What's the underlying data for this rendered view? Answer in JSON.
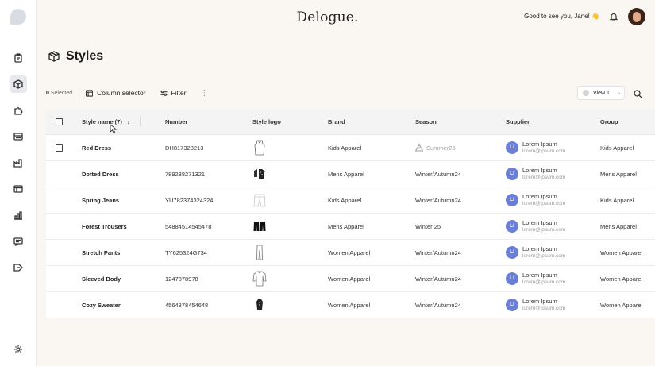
{
  "header": {
    "brand": "Delogue.",
    "greeting": "Good to see you, Jane! 👋"
  },
  "page": {
    "title": "Styles"
  },
  "toolbar": {
    "selected_count": "0",
    "selected_label": "Selected",
    "column_selector_label": "Column selector",
    "filter_label": "Filter",
    "view_label": "View 1"
  },
  "table": {
    "columns": [
      "Style name (7)",
      "Number",
      "Style logo",
      "Brand",
      "Season",
      "Supplier",
      "Group"
    ],
    "rows": [
      {
        "name": "Red Dress",
        "number": "DH817328213",
        "logo": "dress-icon",
        "brand": "Kids Apparel",
        "season": "Summer25",
        "season_warning": true,
        "supplier_initials": "LI",
        "supplier_name": "Lorem Ipsum",
        "supplier_email": "lorem@ipsum.com",
        "group": "Kids Apparel"
      },
      {
        "name": "Dotted Dress",
        "number": "789238271321",
        "logo": "dotted-dress-icon",
        "brand": "Mens Apparel",
        "season": "Winter/Autumn24",
        "season_warning": false,
        "supplier_initials": "LI",
        "supplier_name": "Lorem Ipsum",
        "supplier_email": "lorem@ipsum.com",
        "group": "Mens Apparel"
      },
      {
        "name": "Spring Jeans",
        "number": "YU782374324324",
        "logo": "jeans-icon",
        "brand": "Kids Apparel",
        "season": "Winter/Autumn24",
        "season_warning": false,
        "supplier_initials": "LI",
        "supplier_name": "Lorem Ipsum",
        "supplier_email": "lorem@ipsum.com",
        "group": "Kids Apparel"
      },
      {
        "name": "Forest Trousers",
        "number": "54884514545478",
        "logo": "trousers-icon",
        "brand": "Mens Apparel",
        "season": "Winter 25",
        "season_warning": false,
        "supplier_initials": "LI",
        "supplier_name": "Lorem Ipsum",
        "supplier_email": "lorem@ipsum.com",
        "group": "Mens Apparel"
      },
      {
        "name": "Stretch Pants",
        "number": "TY625324G734",
        "logo": "pants-icon",
        "brand": "Women Apparel",
        "season": "Winter/Autumn24",
        "season_warning": false,
        "supplier_initials": "LI",
        "supplier_name": "Lorem Ipsum",
        "supplier_email": "lorem@ipsum.com",
        "group": "Women Apparel"
      },
      {
        "name": "Sleeved Body",
        "number": "1247878978",
        "logo": "body-icon",
        "brand": "Women Apparel",
        "season": "Winter/Autumn24",
        "season_warning": false,
        "supplier_initials": "LI",
        "supplier_name": "Lorem Ipsum",
        "supplier_email": "lorem@ipsum.com",
        "group": "Women Apparel"
      },
      {
        "name": "Cozy Sweater",
        "number": "4564878454648",
        "logo": "sweater-icon",
        "brand": "Women Apparel",
        "season": "Winter/Autumn24",
        "season_warning": false,
        "supplier_initials": "LI",
        "supplier_name": "Lorem Ipsum",
        "supplier_email": "lorem@ipsum.com",
        "group": "Women Apparel"
      }
    ]
  },
  "sidebar": {
    "items": [
      {
        "icon": "clipboard-icon",
        "active": false
      },
      {
        "icon": "box-icon",
        "active": true
      },
      {
        "icon": "puzzle-icon",
        "active": false
      },
      {
        "icon": "inbox-icon",
        "active": false
      },
      {
        "icon": "factory-icon",
        "active": false
      },
      {
        "icon": "layout-icon",
        "active": false
      },
      {
        "icon": "bar-chart-icon",
        "active": false
      },
      {
        "icon": "message-icon",
        "active": false
      },
      {
        "icon": "tag-icon",
        "active": false
      }
    ],
    "settings_icon": "gear-icon"
  },
  "colors": {
    "background": "#faf6f1",
    "supplier_avatar": "#6b7fd7",
    "active_nav": "#e7e9ee"
  }
}
